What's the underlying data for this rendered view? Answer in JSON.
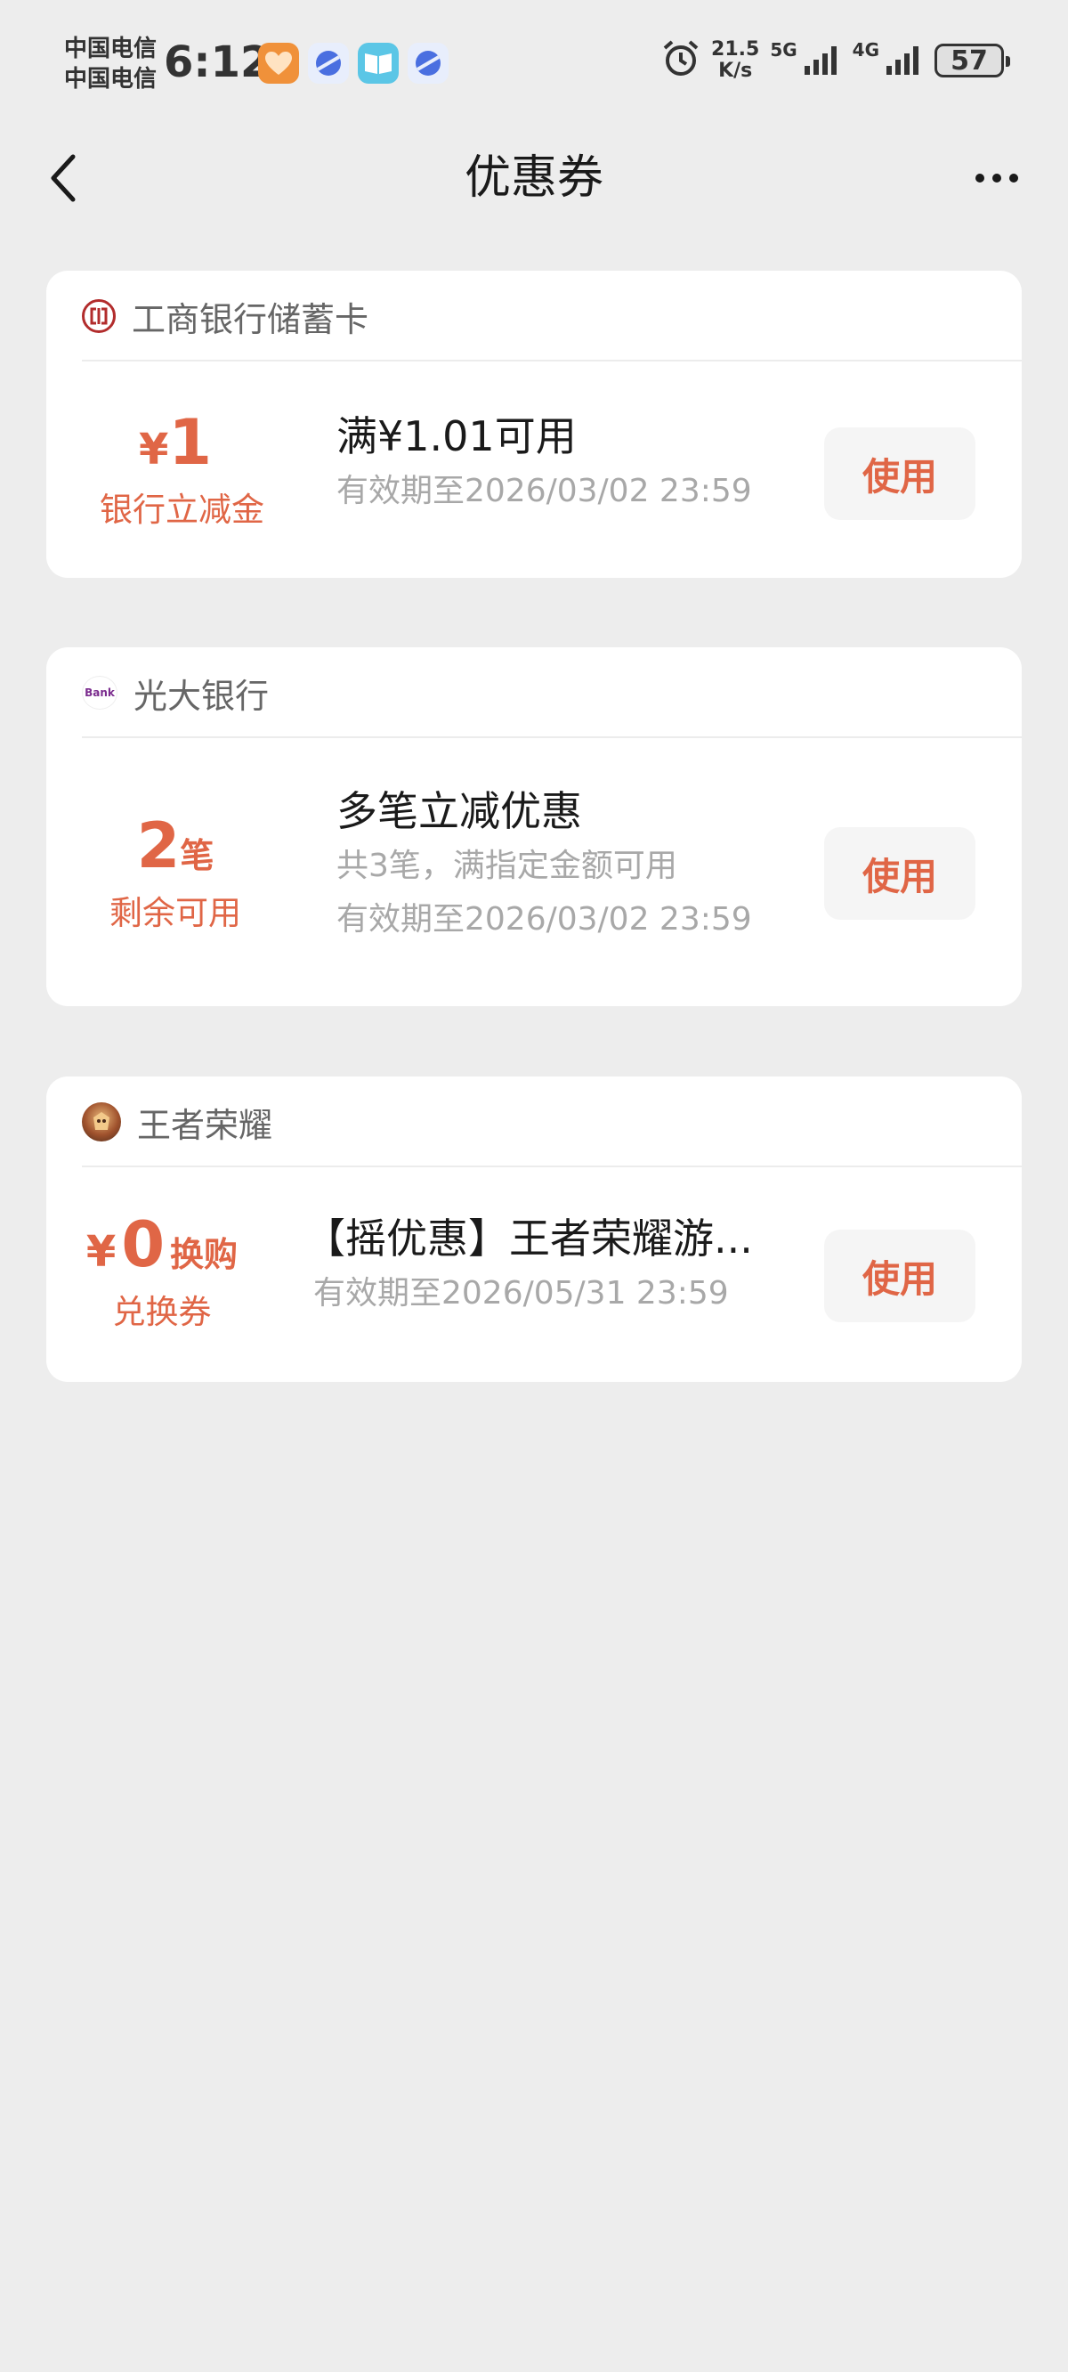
{
  "status_bar": {
    "carrier_1": "中国电信",
    "carrier_2": "中国电信",
    "time": "6:12",
    "net_speed_value": "21.5",
    "net_speed_unit": "K/s",
    "signal_1_label": "5G",
    "signal_2_label": "4G",
    "battery": "57"
  },
  "header": {
    "title": "优惠券"
  },
  "coupons": [
    {
      "issuer": "工商银行储蓄卡",
      "currency": "¥",
      "amount": "1",
      "amount_label": "银行立减金",
      "title": "满¥1.01可用",
      "validity": "有效期至2026/03/02 23:59",
      "button": "使用"
    },
    {
      "issuer": "光大银行",
      "issuer_logo_text": "Bank",
      "amount": "2",
      "amount_unit": "笔",
      "amount_label": "剩余可用",
      "title": "多笔立减优惠",
      "detail": "共3笔，满指定金额可用",
      "validity": "有效期至2026/03/02 23:59",
      "button": "使用"
    },
    {
      "issuer": "王者荣耀",
      "currency": "¥",
      "amount": "0",
      "amount_unit": "换购",
      "amount_label": "兑换券",
      "title": "【摇优惠】王者荣耀游...",
      "validity": "有效期至2026/05/31 23:59",
      "button": "使用"
    }
  ],
  "colors": {
    "accent": "#e06646",
    "background": "#ededed",
    "card": "#ffffff",
    "muted_text": "#a8a8a8"
  }
}
